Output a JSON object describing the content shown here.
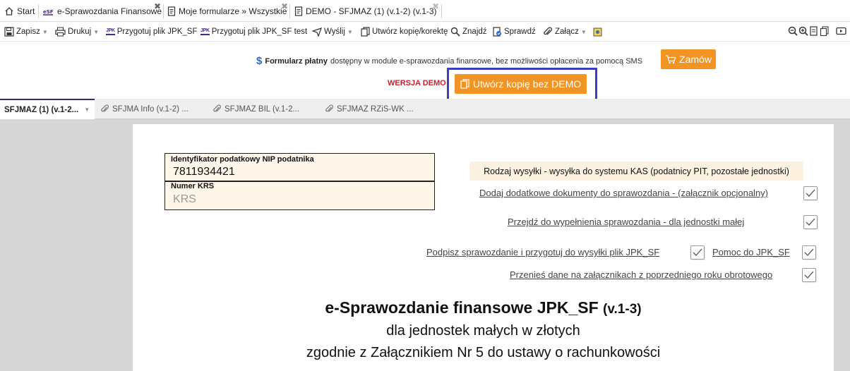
{
  "tabs": [
    {
      "label": "Start",
      "icon": "home-icon"
    },
    {
      "label": "e-Sprawozdania Finansowe",
      "icon": "esf-icon",
      "closable": true
    },
    {
      "label": "Moje formularze » Wszystkie",
      "icon": "document-icon",
      "closable": true
    },
    {
      "label": "DEMO - SFJMAZ (1) (v.1-2) (v.1-3)",
      "icon": "document-icon",
      "closable": true,
      "active": true
    }
  ],
  "toolbar": {
    "save": "Zapisz",
    "print": "Drukuj",
    "prepare_jpk": "Przygotuj plik JPK_SF",
    "prepare_jpk_test": "Przygotuj plik JPK_SF test",
    "send": "Wyślij",
    "copy": "Utwórz kopię/korektę",
    "find": "Znajdź",
    "check": "Sprawdź",
    "attach": "Załącz"
  },
  "notice": {
    "bold": "Formularz płatny",
    "text": "dostępny w module e-sprawozdania finansowe, bez możliwości opłacenia za pomocą SMS",
    "order_button": "Zamów",
    "demo_label": "WERSJA DEMO",
    "copy_button": "Utwórz kopię bez DEMO"
  },
  "form_tabs": [
    {
      "label": "SFJMAZ (1) (v.1-2...",
      "active": true
    },
    {
      "label": "SFJMA Info (v.1-2) ..."
    },
    {
      "label": "SFJMAZ BIL (v.1-2..."
    },
    {
      "label": "SFJMAZ RZiS-WK ..."
    }
  ],
  "form": {
    "nip_label": "Identyfikator podatkowy NIP podatnika",
    "nip_value": "7811934421",
    "krs_label": "Numer KRS",
    "krs_placeholder": "KRS",
    "rodzaj": "Rodzaj wysyłki - wysyłka do systemu KAS (podatnicy PIT, pozostałe jednostki)",
    "link_add_docs": "Dodaj dodatkowe dokumenty do sprawozdania - (załącznik opcjonalny)",
    "link_fill": "Przejdź do wypełnienia sprawozdania - dla jednostki małej",
    "link_sign": "Podpisz sprawozdanie i przygotuj do wysyłki plik JPK_SF",
    "link_help": "Pomoc do JPK_SF",
    "link_transfer": "Przenieś dane na załącznikach z poprzedniego roku obrotowego",
    "title_main": "e-Sprawozdanie finansowe JPK_SF",
    "title_version": "(v.1-3)",
    "subtitle1": "dla jednostek małych w złotych",
    "subtitle2": "zgodnie z Załącznikiem Nr 5 do ustawy o rachunkowości"
  },
  "colors": {
    "accent_orange": "#f29423",
    "highlight_box": "#3a3fb8",
    "demo_red": "#c8202a",
    "field_bg": "#fdf6e9"
  }
}
